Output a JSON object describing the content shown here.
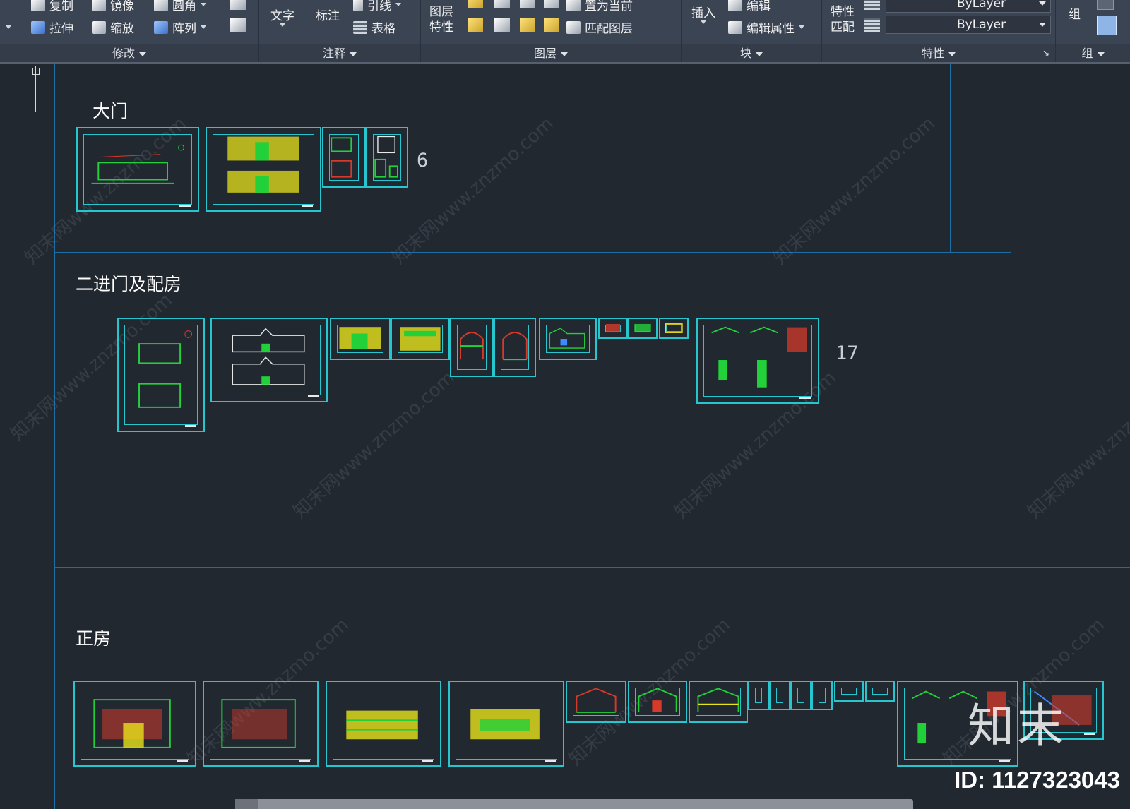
{
  "ribbon": {
    "modify": {
      "title": "修改",
      "copy": "复制",
      "mirror": "镜像",
      "fillet": "圆角",
      "stretch": "拉伸",
      "scale": "缩放",
      "array": "阵列"
    },
    "annotation": {
      "title": "注释",
      "text": "文字",
      "dimension": "标注",
      "leader": "引线",
      "table": "表格"
    },
    "layers": {
      "title": "图层",
      "layer_properties": "图层\n特性",
      "set_current": "置为当前",
      "match_layer": "匹配图层"
    },
    "block": {
      "title": "块",
      "insert": "插入",
      "edit": "编辑",
      "edit_attributes": "编辑属性"
    },
    "properties": {
      "title": "特性",
      "match": "特性\n匹配",
      "color": "ByLayer",
      "linetype": "ByLayer"
    },
    "group": {
      "title": "组",
      "group": "组"
    }
  },
  "drawing": {
    "sections": [
      {
        "title": "大门",
        "count": "6"
      },
      {
        "title": "二进门及配房",
        "count": "17"
      },
      {
        "title": "正房",
        "count": ""
      }
    ],
    "watermark": "知末网www.znzmo.com",
    "logo": "知末",
    "id_label": "ID: 1127323043"
  },
  "colors": {
    "background": "#212830",
    "ribbon": "#3b4453",
    "sheet_border": "#27c6cf",
    "section_border": "#1d6ea6",
    "drawing_green": "#22d13a",
    "drawing_yellow": "#e8e21c",
    "drawing_red": "#d63a2b"
  }
}
